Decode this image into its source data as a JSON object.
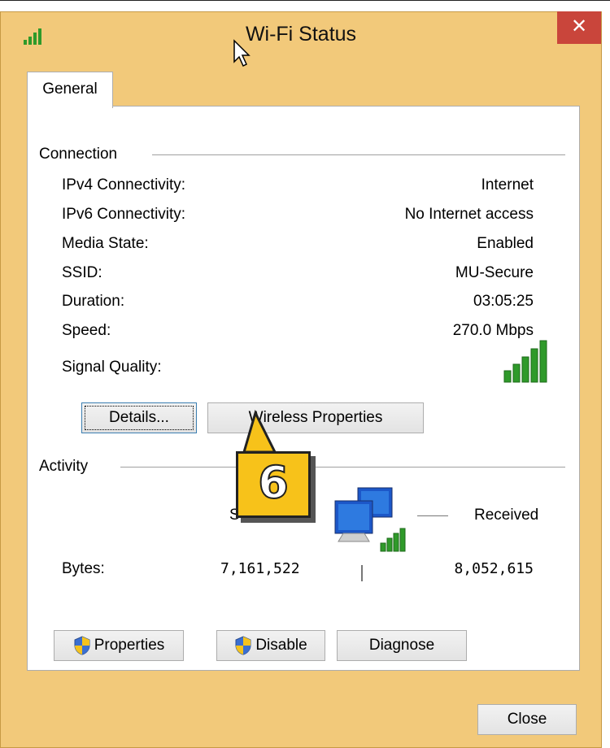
{
  "window": {
    "title": "Wi-Fi Status",
    "close_glyph": "✕"
  },
  "tab": {
    "label": "General"
  },
  "connection": {
    "group_label": "Connection",
    "rows": [
      {
        "key": "IPv4 Connectivity:",
        "value": "Internet"
      },
      {
        "key": "IPv6 Connectivity:",
        "value": "No Internet access"
      },
      {
        "key": "Media State:",
        "value": "Enabled"
      },
      {
        "key": "SSID:",
        "value": "MU-Secure"
      },
      {
        "key": "Duration:",
        "value": "03:05:25"
      },
      {
        "key": "Speed:",
        "value": "270.0 Mbps"
      }
    ],
    "signal_label": "Signal Quality:",
    "signal_bars_filled": 5,
    "signal_bars_total": 5
  },
  "buttons": {
    "details": "Details...",
    "wireless_properties": "Wireless Properties",
    "properties": "Properties",
    "disable": "Disable",
    "diagnose": "Diagnose",
    "close": "Close"
  },
  "activity": {
    "group_label": "Activity",
    "sent_label_partial": "S",
    "received_label": "Received",
    "bytes_label": "Bytes:",
    "bytes_sent": "7,161,522",
    "bytes_received": "8,052,615"
  },
  "callout": {
    "number": "6",
    "color": "#f7c21a"
  },
  "colors": {
    "frame": "#f2c97a",
    "close_red": "#c9453b",
    "signal_green": "#2f9a2a"
  }
}
